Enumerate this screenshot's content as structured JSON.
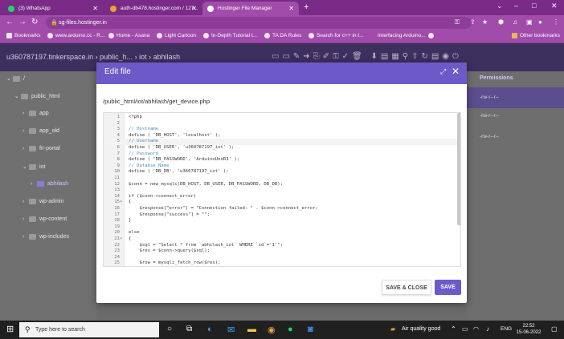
{
  "browser": {
    "tabs": [
      {
        "title": "(3) WhatsApp",
        "favicon_color": "#25d366"
      },
      {
        "title": "auth-db478.hostinger.com / 127...",
        "favicon_color": "#f0a030"
      },
      {
        "title": "Hostinger File Manager",
        "favicon_color": "#ffffff"
      }
    ],
    "url": "sg-files.hostinger.in",
    "bookmarks": [
      "Bookmarks",
      "www.arduino.cc - R...",
      "Home - Asana",
      "Light Cartoon",
      "In-Depth Tutorial t...",
      "TA DA Rules",
      "Search for c++ in t...",
      "Interfacing Arduino...",
      "Other bookmarks"
    ]
  },
  "app": {
    "breadcrumb": "u360787197.tinkerspace.in  ›  public_h...  ›  iot  ›  abhilash",
    "permissions_header": "Permissions",
    "perm_rows": [
      "-rw-r--r--",
      "-rw-r--r--",
      "-rw-r--r--"
    ],
    "tree": [
      {
        "label": "/",
        "depth": 0,
        "open": true
      },
      {
        "label": "public_html",
        "depth": 1,
        "open": true
      },
      {
        "label": "app",
        "depth": 2
      },
      {
        "label": "app_old",
        "depth": 2
      },
      {
        "label": "fir-portal",
        "depth": 2
      },
      {
        "label": "iot",
        "depth": 2,
        "open": true
      },
      {
        "label": "abhilash",
        "depth": 3,
        "selected": true
      },
      {
        "label": "wp-admin",
        "depth": 2
      },
      {
        "label": "wp-content",
        "depth": 2
      },
      {
        "label": "wp-includes",
        "depth": 2
      }
    ]
  },
  "modal": {
    "title": "Edit file",
    "path": "/public_html/iot/abhilash/get_device.php",
    "save_close_label": "SAVE & CLOSE",
    "save_label": "SAVE",
    "current_line": 5,
    "lines": [
      {
        "n": "1",
        "code": "<?php"
      },
      {
        "n": "2",
        "code": ""
      },
      {
        "n": "3",
        "code": "// Hostname",
        "c": "comment"
      },
      {
        "n": "4",
        "code": "define ( 'DB_HOST', 'localhost' );"
      },
      {
        "n": "5",
        "code": "// Username",
        "c": "comment"
      },
      {
        "n": "6",
        "code": "define ( 'DB_USER', 'u360787197_iot' );"
      },
      {
        "n": "7",
        "code": "// Password",
        "c": "comment"
      },
      {
        "n": "8",
        "code": "define ( 'DB_PASSWORD', 'ArduinoUnoR3' );"
      },
      {
        "n": "9",
        "code": "// Databse Name",
        "c": "comment"
      },
      {
        "n": "10",
        "code": "define ( 'DB_DB', 'u360787197_iot' );"
      },
      {
        "n": "11",
        "code": ""
      },
      {
        "n": "12",
        "code": "$conn = new mysqli(DB_HOST, DB_USER, DB_PASSWORD, DB_DB);"
      },
      {
        "n": "13",
        "code": ""
      },
      {
        "n": "14",
        "code": "if ($conn->connect_error)"
      },
      {
        "n": "15",
        "fold": "▾",
        "code": "{"
      },
      {
        "n": "16",
        "code": "    $response[\"error\"] = \"Connection failed: \" . $conn->connect_error;"
      },
      {
        "n": "17",
        "code": "    $response[\"success\"] = \"\";"
      },
      {
        "n": "18",
        "code": "}"
      },
      {
        "n": "19",
        "code": ""
      },
      {
        "n": "20",
        "code": "else"
      },
      {
        "n": "21",
        "fold": "▾",
        "code": "{"
      },
      {
        "n": "22",
        "code": "    $sql = \"Select * from `abhilash_iot` WHERE `id`='1'\";"
      },
      {
        "n": "23",
        "code": "    $res = $conn->query($sql);"
      },
      {
        "n": "24",
        "code": ""
      },
      {
        "n": "25",
        "code": "    $row = mysqli_fetch_row($res);"
      }
    ]
  },
  "taskbar": {
    "search_placeholder": "Type here to search",
    "weather": "Air quality good",
    "lang": "ENG",
    "time": "22:52",
    "date": "15-06-2022"
  },
  "colors": {
    "accent": "#6e59c9",
    "browser": "#a14cab",
    "comment": "#4a8fbf",
    "string": "#a33a3a"
  }
}
